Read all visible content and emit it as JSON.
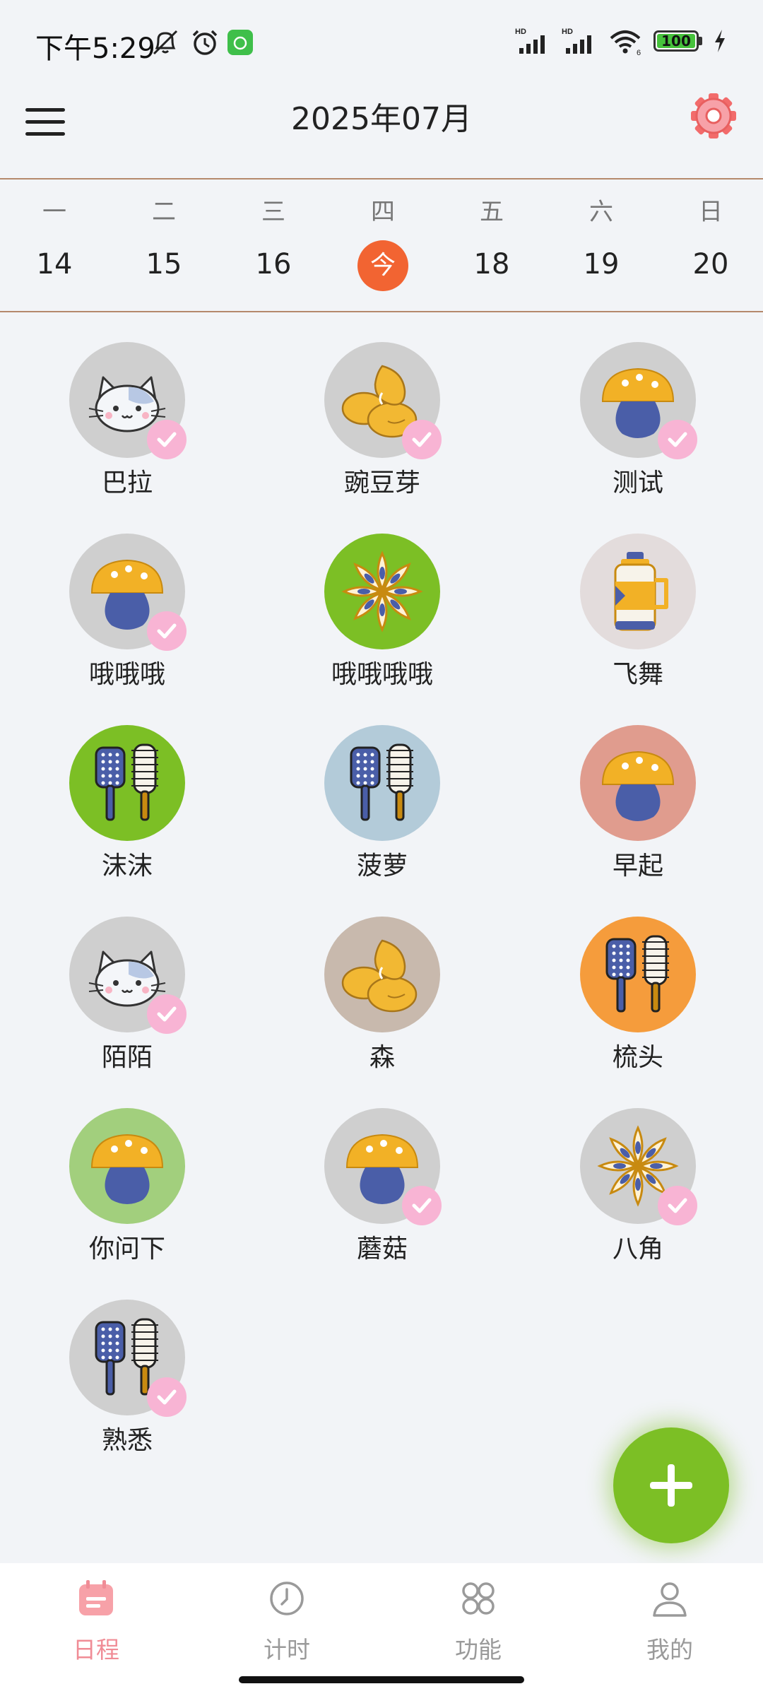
{
  "status_bar": {
    "time": "下午5:29",
    "battery_level": "100",
    "battery_fraction": 1.0
  },
  "header": {
    "title": "2025年07月",
    "menu_icon": "hamburger-menu-icon",
    "settings_icon": "gear-icon"
  },
  "week": {
    "days": [
      {
        "name": "一",
        "num": "14"
      },
      {
        "name": "二",
        "num": "15"
      },
      {
        "name": "三",
        "num": "16"
      },
      {
        "name": "四",
        "num": "今",
        "today": true
      },
      {
        "name": "五",
        "num": "18"
      },
      {
        "name": "六",
        "num": "19"
      },
      {
        "name": "日",
        "num": "20"
      }
    ]
  },
  "colors": {
    "accent_green": "#7cbf25",
    "today_orange": "#f26432",
    "check_pink": "#f8b4d4",
    "nav_active": "#f08c96"
  },
  "habits": [
    {
      "label": "巴拉",
      "icon": "cat-icon",
      "bg": "#cfcfcf",
      "done": true
    },
    {
      "label": "豌豆芽",
      "icon": "peach-icon",
      "bg": "#cfcfcf",
      "done": true
    },
    {
      "label": "测试",
      "icon": "mushroom-icon",
      "bg": "#cfcfcf",
      "done": true
    },
    {
      "label": "哦哦哦",
      "icon": "mushroom-icon",
      "bg": "#cfcfcf",
      "done": true
    },
    {
      "label": "哦哦哦哦",
      "icon": "star-anise-icon",
      "bg": "#7cbf25",
      "done": false
    },
    {
      "label": "飞舞",
      "icon": "thermos-icon",
      "bg": "#e3dcdc",
      "done": false
    },
    {
      "label": "沫沫",
      "icon": "brush-icon",
      "bg": "#7cbf25",
      "done": false
    },
    {
      "label": "菠萝",
      "icon": "brush-icon",
      "bg": "#b3cbd9",
      "done": false
    },
    {
      "label": "早起",
      "icon": "mushroom-icon",
      "bg": "#e09c8e",
      "done": false
    },
    {
      "label": "陌陌",
      "icon": "cat-icon",
      "bg": "#cfcfcf",
      "done": true
    },
    {
      "label": "森",
      "icon": "peach-icon",
      "bg": "#c8b9ad",
      "done": false
    },
    {
      "label": "梳头",
      "icon": "brush-icon",
      "bg": "#f59c3c",
      "done": false
    },
    {
      "label": "你问下",
      "icon": "mushroom-icon",
      "bg": "#a2cf7d",
      "done": false
    },
    {
      "label": "蘑菇",
      "icon": "mushroom-icon",
      "bg": "#cfcfcf",
      "done": true
    },
    {
      "label": "八角",
      "icon": "star-anise-icon",
      "bg": "#cfcfcf",
      "done": true
    },
    {
      "label": "熟悉",
      "icon": "brush-icon",
      "bg": "#cfcfcf",
      "done": true
    }
  ],
  "fab": {
    "icon": "plus-icon"
  },
  "bottom_nav": [
    {
      "label": "日程",
      "icon": "calendar-icon",
      "active": true
    },
    {
      "label": "计时",
      "icon": "clock-icon",
      "active": false
    },
    {
      "label": "功能",
      "icon": "grid-icon",
      "active": false
    },
    {
      "label": "我的",
      "icon": "person-icon",
      "active": false
    }
  ]
}
